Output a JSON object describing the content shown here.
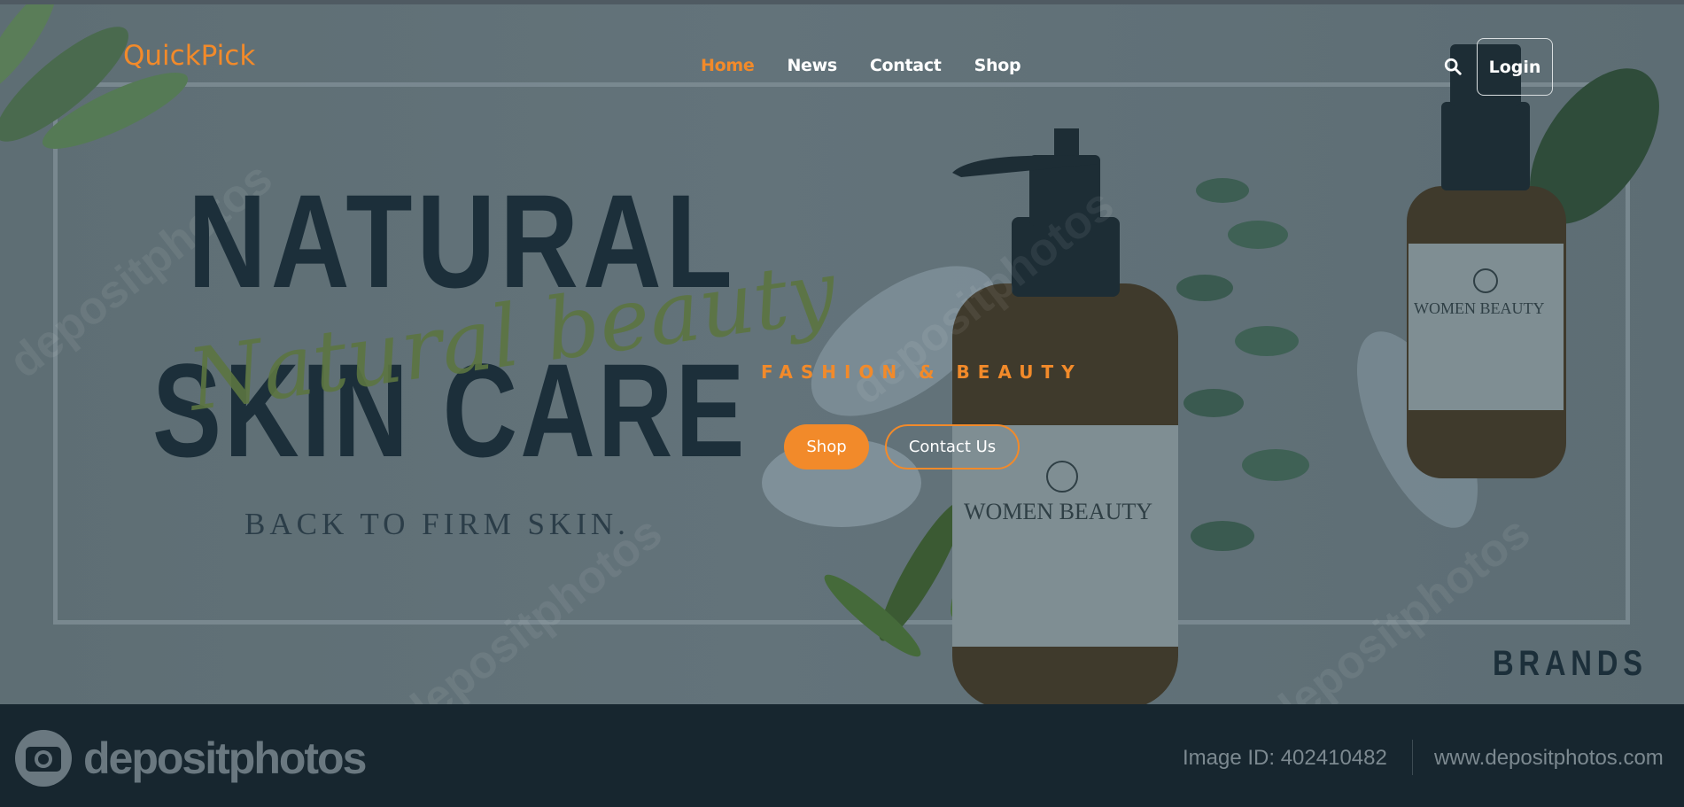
{
  "brand": "QuickPick",
  "nav": {
    "home": "Home",
    "news": "News",
    "contact": "Contact",
    "shop": "Shop"
  },
  "login_label": "Login",
  "hero": {
    "headline1": "NATURAL",
    "script": "Natural beauty",
    "headline2": "SKIN CARE",
    "subline": "BACK TO FIRM SKIN.",
    "tagline": "FASHION & BEAUTY",
    "shop_label": "Shop",
    "contact_label": "Contact Us",
    "bottle_label": "WOMEN BEAUTY",
    "brands": "BRANDS"
  },
  "watermark": {
    "logo": "depositphotos",
    "image_id": "Image ID: 402410482",
    "site": "www.depositphotos.com"
  },
  "colors": {
    "accent": "#f28a2a",
    "dark": "#1c2f3a",
    "footer": "#17262f"
  }
}
